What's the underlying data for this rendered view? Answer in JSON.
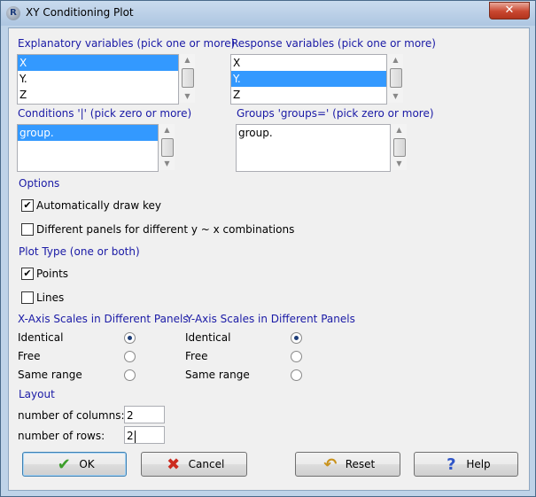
{
  "window": {
    "title": "XY Conditioning Plot",
    "close_glyph": "✕"
  },
  "explanatory": {
    "label": "Explanatory variables (pick one or more)",
    "items": [
      "X",
      "Y.",
      "Z"
    ],
    "selected_index": 0
  },
  "response": {
    "label": "Response variables (pick one or more)",
    "items": [
      "X",
      "Y.",
      "Z"
    ],
    "selected_index": 1
  },
  "conditions": {
    "label": "Conditions '|' (pick zero or more)",
    "items": [
      "group."
    ],
    "selected_index": 0
  },
  "groups": {
    "label": "Groups 'groups=' (pick zero or more)",
    "items": [
      "group."
    ]
  },
  "options": {
    "heading": "Options",
    "auto_key": {
      "label": "Automatically draw key",
      "checked": true,
      "mark": "✔"
    },
    "diff_panels": {
      "label": "Different panels for different y ~ x combinations",
      "checked": false
    }
  },
  "plot_type": {
    "heading": "Plot Type (one or both)",
    "points": {
      "label": "Points",
      "checked": true,
      "mark": "✔"
    },
    "lines": {
      "label": "Lines",
      "checked": false
    }
  },
  "x_scales": {
    "heading": "X-Axis Scales in Different Panels",
    "options": [
      "Identical",
      "Free",
      "Same range"
    ],
    "selected": "Identical"
  },
  "y_scales": {
    "heading": "Y-Axis Scales in Different Panels",
    "options": [
      "Identical",
      "Free",
      "Same range"
    ],
    "selected": "Identical"
  },
  "layout": {
    "heading": "Layout",
    "columns_label": "number of columns:",
    "columns_value": "2",
    "rows_label": "number of rows:",
    "rows_value": "2"
  },
  "buttons": {
    "ok": "OK",
    "cancel": "Cancel",
    "reset": "Reset",
    "help": "Help"
  },
  "icons": {
    "ok": "check-icon",
    "cancel": "x-icon",
    "reset": "undo-arrow-icon",
    "help": "question-icon"
  },
  "colors": {
    "heading_blue": "#1a1aa6",
    "selection": "#3399ff",
    "ok_green": "#3c9e2a",
    "cancel_red": "#cc2a1e",
    "reset_gold": "#c9921c",
    "help_blue": "#2f55c8"
  }
}
